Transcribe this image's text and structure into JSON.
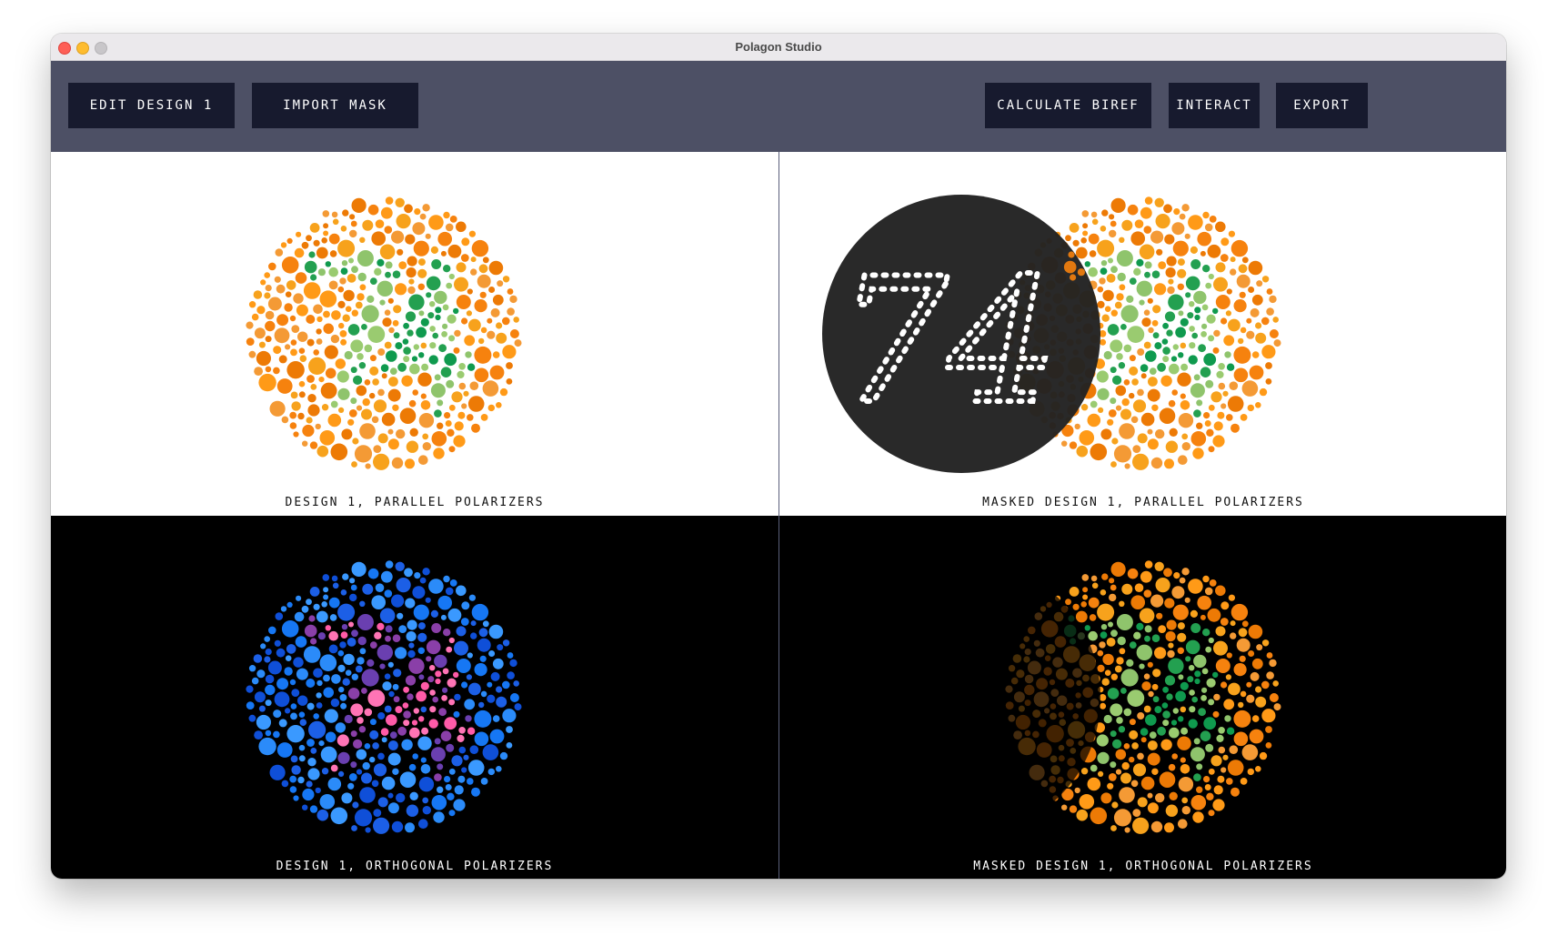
{
  "window": {
    "title": "Polagon Studio"
  },
  "toolbar": {
    "edit_label": "EDIT DESIGN 1",
    "import_label": "IMPORT MASK",
    "calc_label": "CALCULATE BIREF",
    "interact_label": "INTERACT",
    "export_label": "EXPORT"
  },
  "panels": {
    "parallel": {
      "caption": "DESIGN 1, PARALLEL POLARIZERS"
    },
    "masked_parallel": {
      "caption": "MASKED DESIGN 1, PARALLEL POLARIZERS",
      "mask_text": "74"
    },
    "orthogonal": {
      "caption": "DESIGN 1, ORTHOGONAL POLARIZERS"
    },
    "masked_orthogonal": {
      "caption": "MASKED DESIGN 1, ORTHOGONAL POLARIZERS"
    }
  },
  "colors": {
    "toolbar_bg": "#4d5065",
    "button_bg": "#171a2e",
    "parallel_bg": [
      "#f6820e",
      "#f7a21c",
      "#ff9a17",
      "#f49a35",
      "#ed7a05"
    ],
    "parallel_fg": [
      "#0f9a4e",
      "#8fc46c",
      "#23a050",
      "#9acb70"
    ],
    "ortho_bg": [
      "#1677f4",
      "#1c5fe6",
      "#2b8bf9",
      "#0f4fd8",
      "#3a99ff"
    ],
    "ortho_fg": [
      "#ff5ba8",
      "#6a3fb0",
      "#8a3fa8",
      "#ff74b5"
    ],
    "mask_fill": "#222222"
  }
}
